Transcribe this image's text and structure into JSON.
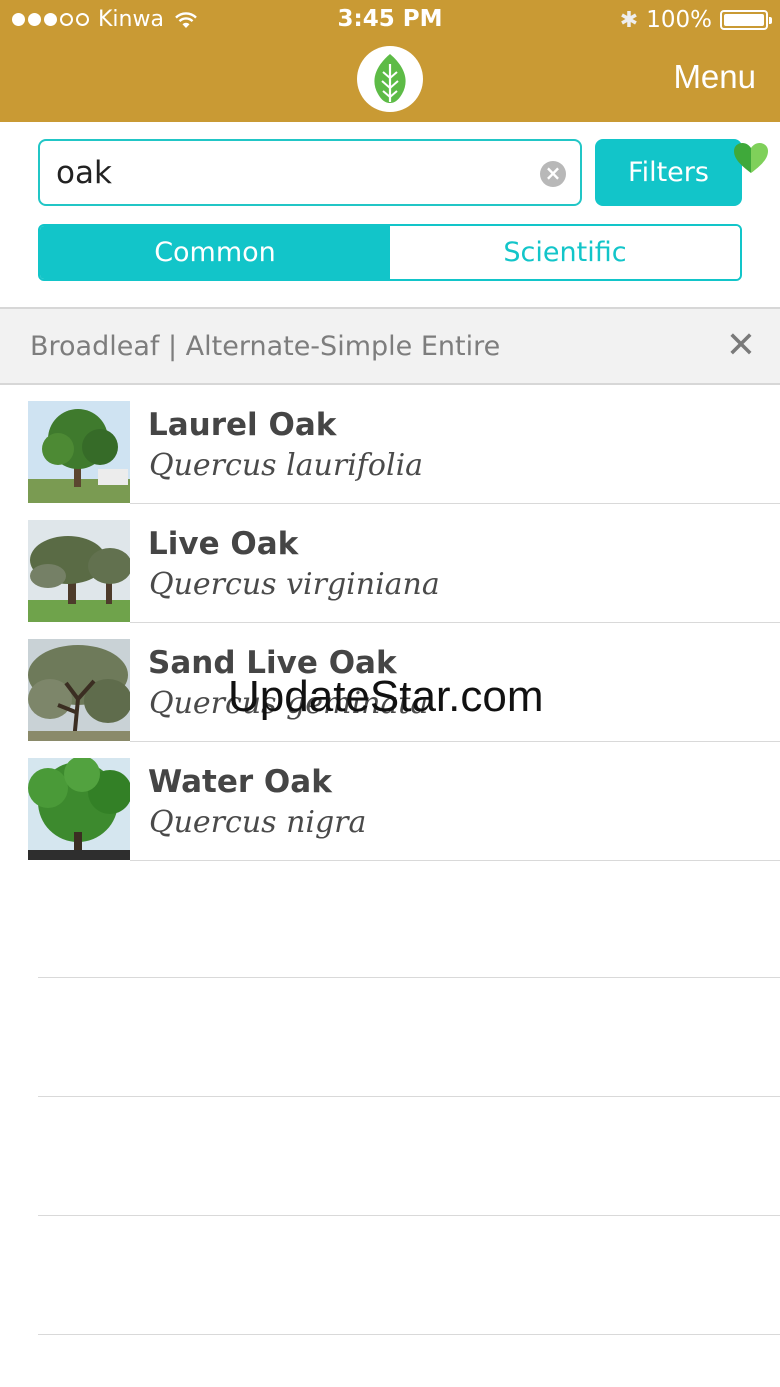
{
  "status_bar": {
    "carrier": "Kinwa",
    "time": "3:45 PM",
    "battery": "100%"
  },
  "header": {
    "logo_icon": "leaf-icon",
    "menu_label": "Menu"
  },
  "search": {
    "value": "oak",
    "clear_icon": "clear-icon",
    "filters_label": "Filters"
  },
  "segments": {
    "common_label": "Common",
    "scientific_label": "Scientific",
    "selected": "Common"
  },
  "filter_bar": {
    "text": "Broadleaf | Alternate-Simple Entire",
    "close_icon": "close-icon"
  },
  "results": [
    {
      "common": "Laurel Oak",
      "scientific": "Quercus laurifolia",
      "favorite": false
    },
    {
      "common": "Live Oak",
      "scientific": "Quercus virginiana",
      "favorite": true
    },
    {
      "common": "Sand Live Oak",
      "scientific": "Quercus geminata",
      "favorite": false
    },
    {
      "common": "Water Oak",
      "scientific": "Quercus nigra",
      "favorite": false
    }
  ],
  "watermark": "UpdateStar.com",
  "colors": {
    "header": "#c99a34",
    "accent": "#12c5c9",
    "favorite": "#5dbb46"
  }
}
